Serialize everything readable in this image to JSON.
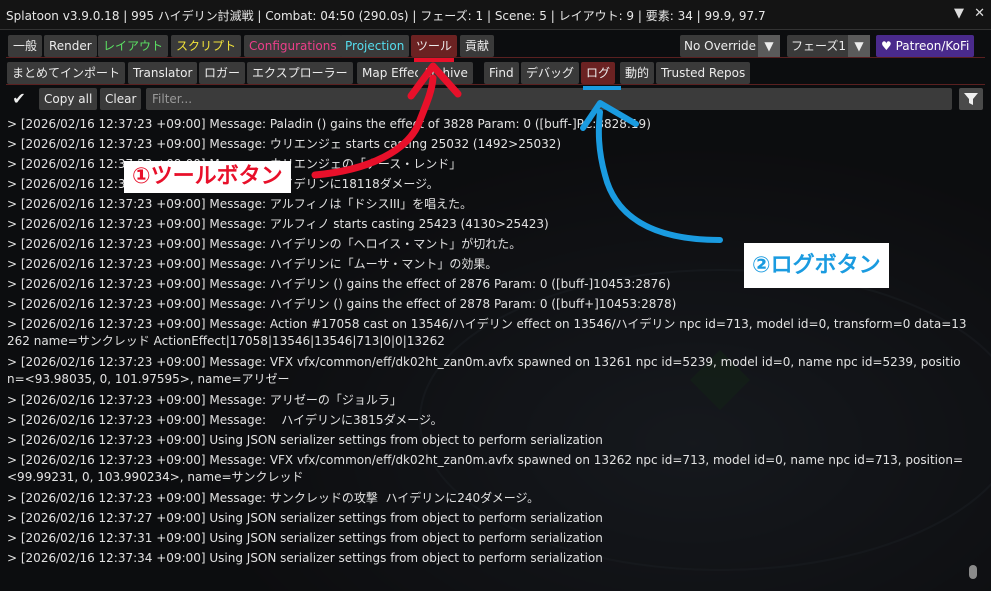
{
  "window": {
    "title": "Splatoon v3.9.0.18 | 995 ハイデリン討滅戦 | Combat: 04:50 (290.0s) | フェーズ: 1 | Scene: 5 | レイアウト: 9 | 要素: 34 | 99.9, 97.7",
    "collapse_glyph": "▼",
    "close_glyph": "✕"
  },
  "main_tabs": [
    {
      "label": "一般"
    },
    {
      "label": "Render"
    },
    {
      "label": "レイアウト"
    },
    {
      "label": "スクリプト"
    },
    {
      "label": "Configurations"
    },
    {
      "label": "Projection"
    },
    {
      "label": "ツール"
    },
    {
      "label": "貢献"
    }
  ],
  "right_controls": {
    "override": "No Override",
    "phase": "フェーズ1",
    "patreon": "♥ Patreon/KoFi"
  },
  "tool_tabs": [
    {
      "label": "まとめてインポート"
    },
    {
      "label": "Translator"
    },
    {
      "label": "ロガー"
    },
    {
      "label": "エクスプローラー"
    },
    {
      "label": "Map Effect"
    },
    {
      "label": "Archive"
    },
    {
      "label": "Find"
    },
    {
      "label": "デバッグ"
    },
    {
      "label": "ログ"
    },
    {
      "label": "動的"
    },
    {
      "label": "Trusted Repos"
    }
  ],
  "toolbar": {
    "copy_all": "Copy all",
    "clear": "Clear",
    "filter_placeholder": "Filter..."
  },
  "logs": [
    "> [2026/02/16 12:37:23 +09:00] Message: Paladin () gains the effect of 3828 Param: 0 ([buff-]PC:3828:19)",
    "> [2026/02/16 12:37:23 +09:00] Message: ウリエンジェ starts casting 25032 (1492>25032)",
    "> [2026/02/16 12:37:23 +09:00] Message: ウリエンジェの「ナース・レンド」",
    "> [2026/02/16 12:37:23 +09:00] Message: ハイデリンに18118ダメージ。",
    "> [2026/02/16 12:37:23 +09:00] Message: アルフィノは「ドシスIII」を唱えた。",
    "> [2026/02/16 12:37:23 +09:00] Message: アルフィノ starts casting 25423 (4130>25423)",
    "> [2026/02/16 12:37:23 +09:00] Message: ハイデリンの「ヘロイス・マント」が切れた。",
    "> [2026/02/16 12:37:23 +09:00] Message: ハイデリンに「ムーサ・マント」の効果。",
    "> [2026/02/16 12:37:23 +09:00] Message: ハイデリン () gains the effect of 2876 Param: 0 ([buff-]10453:2876)",
    "> [2026/02/16 12:37:23 +09:00] Message: ハイデリン () gains the effect of 2878 Param: 0 ([buff+]10453:2878)",
    "> [2026/02/16 12:37:23 +09:00] Message: Action #17058 cast on 13546/ハイデリン effect on 13546/ハイデリン npc id=713, model id=0, transform=0 data=13262 name=サンクレッド ActionEffect|17058|13546|13546|713|0|0|13262",
    "> [2026/02/16 12:37:23 +09:00] Message: VFX vfx/common/eff/dk02ht_zan0m.avfx spawned on 13261 npc id=5239, model id=0, name npc id=5239, position=<93.98035, 0, 101.97595>, name=アリゼー",
    "> [2026/02/16 12:37:23 +09:00] Message: アリゼーの「ジョルラ」",
    "> [2026/02/16 12:37:23 +09:00] Message:    ハイデリンに3815ダメージ。",
    "> [2026/02/16 12:37:23 +09:00] Using JSON serializer settings from object to perform serialization",
    "> [2026/02/16 12:37:23 +09:00] Message: VFX vfx/common/eff/dk02ht_zan0m.avfx spawned on 13262 npc id=713, model id=0, name npc id=713, position=<99.99231, 0, 103.990234>, name=サンクレッド",
    "> [2026/02/16 12:37:23 +09:00] Message: サンクレッドの攻撃  ハイデリンに240ダメージ。",
    "> [2026/02/16 12:37:27 +09:00] Using JSON serializer settings from object to perform serialization",
    "> [2026/02/16 12:37:31 +09:00] Using JSON serializer settings from object to perform serialization",
    "> [2026/02/16 12:37:34 +09:00] Using JSON serializer settings from object to perform serialization"
  ],
  "annotations": {
    "tool_button": "①ツールボタン",
    "log_button": "②ログボタン",
    "red": "#e8102a",
    "blue": "#1a9be0"
  },
  "colors": {
    "active_tab": "#6b2222",
    "green": "#5be063",
    "yellow": "#f2e33a",
    "pink": "#ec3f8a",
    "cyan": "#55ddee",
    "patreon": "#4a2a8c"
  }
}
